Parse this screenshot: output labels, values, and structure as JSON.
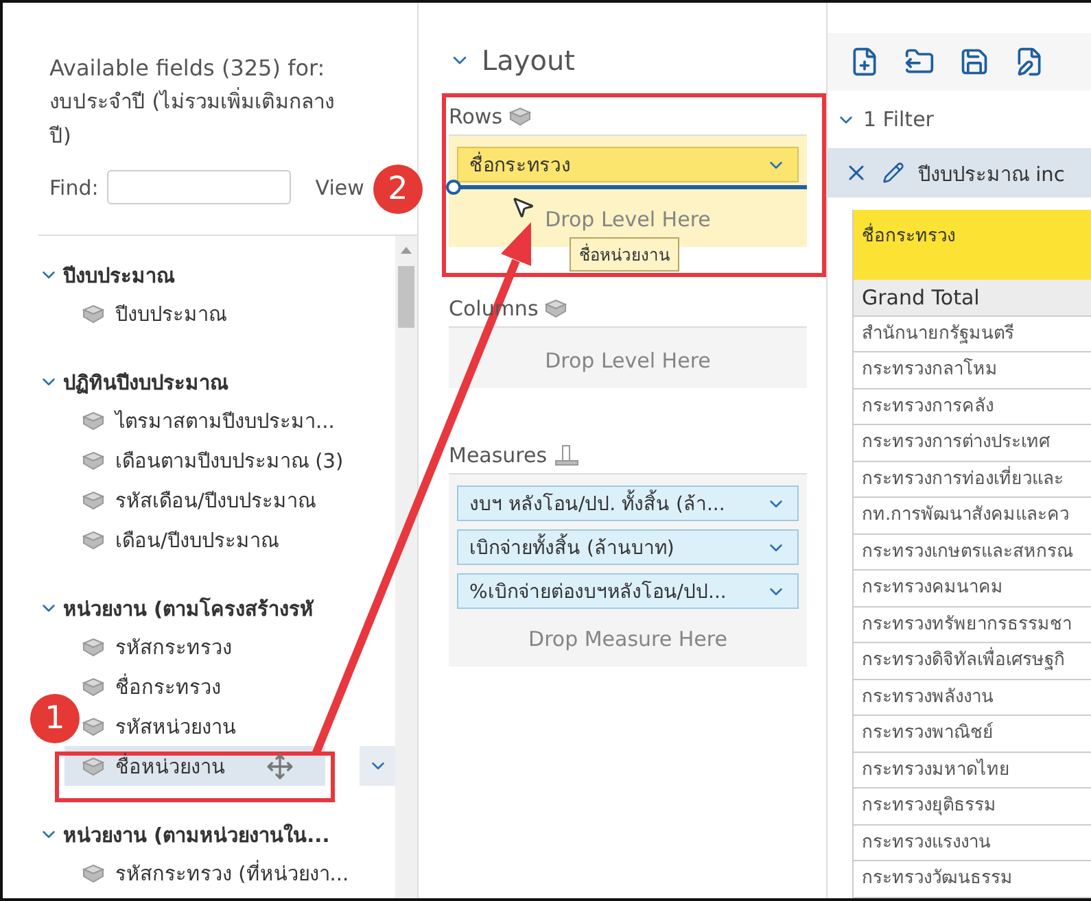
{
  "fields_panel": {
    "title": "Available fields (325) for:",
    "cube_name": "งบประจำปี (ไม่รวมเพิ่มเติมกลางปี)",
    "find_label": "Find:",
    "view_label": "View",
    "groups": [
      {
        "label": "ปีงบประมาณ",
        "expanded": true,
        "children": [
          {
            "label": "ปีงบประมาณ",
            "selected": false
          }
        ]
      },
      {
        "label": "ปฏิทินปีงบประมาณ",
        "expanded": true,
        "children": [
          {
            "label": "ไตรมาสตามปีงบประมา...",
            "selected": false
          },
          {
            "label": "เดือนตามปีงบประมาณ (3)",
            "selected": false
          },
          {
            "label": "รหัสเดือน/ปีงบประมาณ",
            "selected": false
          },
          {
            "label": "เดือน/ปีงบประมาณ",
            "selected": false
          }
        ]
      },
      {
        "label": "หน่วยงาน (ตามโครงสร้างรหั",
        "expanded": true,
        "children": [
          {
            "label": "รหัสกระทรวง",
            "selected": false
          },
          {
            "label": "ชื่อกระทรวง",
            "selected": false
          },
          {
            "label": "รหัสหน่วยงาน",
            "selected": false
          },
          {
            "label": "ชื่อหน่วยงาน",
            "selected": true
          }
        ]
      },
      {
        "label": "หน่วยงาน (ตามหน่วยงานใน...",
        "expanded": true,
        "children": [
          {
            "label": "รหัสกระทรวง (ที่หน่วยงา...",
            "selected": false
          }
        ]
      }
    ]
  },
  "layout": {
    "title": "Layout",
    "rows": {
      "label": "Rows",
      "levels": [
        "ชื่อกระทรวง"
      ],
      "placeholder": "Drop Level Here"
    },
    "drag_tooltip": "ชื่อหน่วยงาน",
    "columns": {
      "label": "Columns",
      "placeholder": "Drop Level Here"
    },
    "measures": {
      "label": "Measures",
      "items": [
        "งบฯ หลังโอน/ปป. ทั้งสิ้น (ล้า...",
        "เบิกจ่ายทั้งสิ้น (ล้านบาท)",
        "%เบิกจ่ายต่องบฯหลังโอน/ปป..."
      ],
      "placeholder": "Drop Measure Here"
    }
  },
  "report": {
    "filter_header": "1 Filter",
    "filter": "ปีงบประมาณ inc",
    "table": {
      "header": "ชื่อกระทรวง",
      "rows": [
        {
          "label": "Grand Total",
          "kind": "total"
        },
        {
          "label": "สำนักนายกรัฐมนตรี",
          "kind": "item"
        },
        {
          "label": "กระทรวงกลาโหม",
          "kind": "item"
        },
        {
          "label": "กระทรวงการคลัง",
          "kind": "item"
        },
        {
          "label": "กระทรวงการต่างประเทศ",
          "kind": "item"
        },
        {
          "label": "กระทรวงการท่องเที่ยวและ",
          "kind": "item"
        },
        {
          "label": "กท.การพัฒนาสังคมและคว",
          "kind": "item"
        },
        {
          "label": "กระทรวงเกษตรและสหกรณ",
          "kind": "item"
        },
        {
          "label": "กระทรวงคมนาคม",
          "kind": "item"
        },
        {
          "label": "กระทรวงทรัพยากรธรรมชา",
          "kind": "item"
        },
        {
          "label": "กระทรวงดิจิทัลเพื่อเศรษฐกิ",
          "kind": "item"
        },
        {
          "label": "กระทรวงพลังงาน",
          "kind": "item"
        },
        {
          "label": "กระทรวงพาณิชย์",
          "kind": "item"
        },
        {
          "label": "กระทรวงมหาดไทย",
          "kind": "item"
        },
        {
          "label": "กระทรวงยุติธรรม",
          "kind": "item"
        },
        {
          "label": "กระทรวงแรงงาน",
          "kind": "item"
        },
        {
          "label": "กระทรวงวัฒนธรรม",
          "kind": "item"
        }
      ]
    }
  },
  "annotations": [
    {
      "label": "1"
    },
    {
      "label": "2"
    }
  ]
}
